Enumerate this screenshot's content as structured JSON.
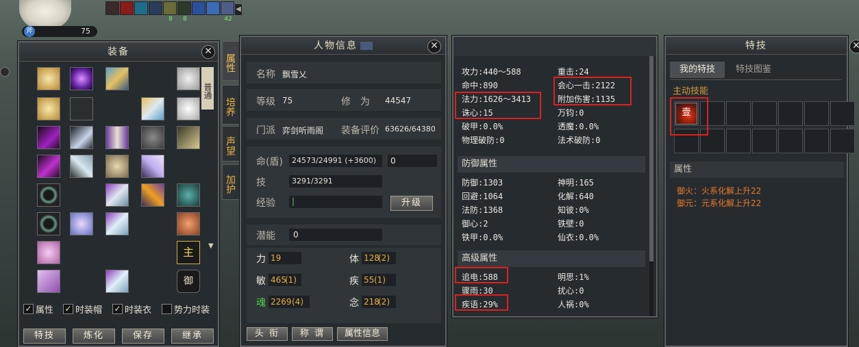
{
  "hud": {
    "level": "75",
    "class_icon_char": "斧",
    "buffs": [
      {
        "color": "#3b2a2a",
        "name": "buff-icon-1",
        "count": ""
      },
      {
        "color": "#8b1a1a",
        "name": "buff-icon-2",
        "count": ""
      },
      {
        "color": "#1f6d8c",
        "name": "buff-icon-3",
        "count": ""
      },
      {
        "color": "#2a3c5a",
        "name": "buff-icon-4",
        "count": ""
      },
      {
        "color": "#6b6a3a",
        "name": "buff-icon-5",
        "count": "8"
      },
      {
        "color": "#2c3a2c",
        "name": "buff-icon-6",
        "count": "8"
      },
      {
        "color": "#2b50a0",
        "name": "buff-icon-7",
        "count": ""
      },
      {
        "color": "#3b6ab8",
        "name": "buff-icon-8",
        "count": ""
      },
      {
        "color": "#4d5c8a",
        "name": "buff-icon-9",
        "count": "42"
      }
    ]
  },
  "equip_panel": {
    "title": "装备",
    "style_label": "普通",
    "slot_main": "主",
    "slot_ride": "御",
    "checkboxes": [
      {
        "label": "属性",
        "checked": true
      },
      {
        "label": "时装帽",
        "checked": true
      },
      {
        "label": "时装衣",
        "checked": true
      },
      {
        "label": "势力时装",
        "checked": false
      }
    ],
    "buttons": [
      "特技",
      "炼化",
      "保存",
      "继承"
    ]
  },
  "side_tabs": [
    "属性",
    "培养",
    "声望",
    "加护"
  ],
  "char_panel": {
    "title": "人物信息",
    "name_label": "名称",
    "name_value": "飘雪乂",
    "level_label": "等级",
    "level_value": "75",
    "cultivation_label": "修　为",
    "cultivation_value": "44547",
    "faction_label": "门派",
    "faction_value": "弈剑听雨阁",
    "rating_label": "装备评价",
    "rating_value": "63626/64380",
    "hp_label": "命(盾)",
    "hp_value": "24573/24991 (+3600)",
    "shield_value": "0",
    "skill_label": "技",
    "skill_value": "3291/3291",
    "exp_label": "经验",
    "exp_value": "|",
    "levelup_button": "升级",
    "potential_label": "潜能",
    "potential_value": "0",
    "attrs": [
      {
        "label": "力",
        "value": "19",
        "bonus": ""
      },
      {
        "label": "体",
        "value": "128",
        "bonus": "(2)"
      },
      {
        "label": "敏",
        "value": "465",
        "bonus": "(1)"
      },
      {
        "label": "疾",
        "value": "55",
        "bonus": "(1)"
      },
      {
        "label": "魂",
        "value": "2269",
        "bonus": "(4)"
      },
      {
        "label": "念",
        "value": "218",
        "bonus": "(2)"
      }
    ],
    "buttons": [
      "头 衔",
      "称 谓",
      "属性信息"
    ]
  },
  "stats_panel": {
    "attack_lines_left": [
      "攻力:440～588",
      "命中:890",
      "法力:1626～3413",
      "诛心:15",
      "破甲:0.0%",
      "物理破防:0"
    ],
    "attack_lines_right": [
      "重击:24",
      "会心一击:2122",
      "附加伤害:1135",
      "万钧:0",
      "透魔:0.0%",
      "法术破防:0"
    ],
    "defense_title": "防御属性",
    "defense_left": [
      "防御:1303",
      "回避:1064",
      "法防:1368",
      "御心:2",
      "铁甲:0.0%"
    ],
    "defense_right": [
      "神明:165",
      "化解:640",
      "知彼:0%",
      "铁壁:0",
      "仙衣:0.0%"
    ],
    "advanced_title": "高级属性",
    "advanced_left": [
      "追电:588",
      "骤雨:30",
      "疾语:29%"
    ],
    "advanced_right": [
      "明思:1%",
      "扰心:0",
      "人祸:0%"
    ]
  },
  "skill_panel": {
    "title": "特技",
    "tab_mine": "我的特技",
    "tab_catalog": "特技图鉴",
    "active_label": "主动技能",
    "skill_glyph": "壹",
    "attr_label": "属性",
    "attr_lines": [
      "御火：火系化解上升22",
      "御元：元系化解上升22"
    ]
  }
}
